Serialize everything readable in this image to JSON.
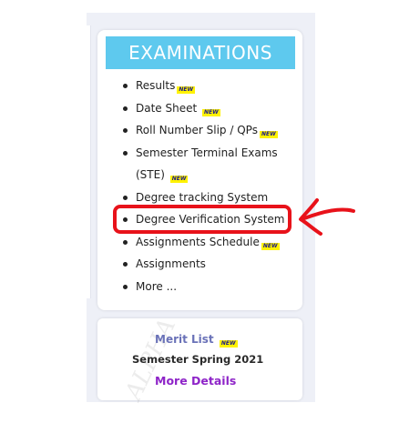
{
  "colors": {
    "header_bg": "#5ec9ee",
    "badge_bg": "#fff200",
    "badge_text": "#1a1a8c",
    "highlight": "#e8121a",
    "merit_title": "#6a72b8",
    "more_details": "#8e24c8"
  },
  "examinations": {
    "title": "EXAMINATIONS",
    "badge_label": "NEW",
    "items": [
      {
        "label": "Results"
      },
      {
        "label": "Date Sheet"
      },
      {
        "label": "Roll Number Slip / QPs"
      },
      {
        "label": "Semester Terminal Exams"
      },
      {
        "label": "(STE)"
      },
      {
        "label": "Degree tracking System"
      },
      {
        "label": "Degree Verification System"
      },
      {
        "label": "Assignments Schedule"
      },
      {
        "label": "Assignments"
      },
      {
        "label": "More ..."
      }
    ]
  },
  "merit": {
    "title": "Merit List",
    "badge_label": "NEW",
    "subtitle": "Semester Spring 2021",
    "link": "More Details"
  }
}
